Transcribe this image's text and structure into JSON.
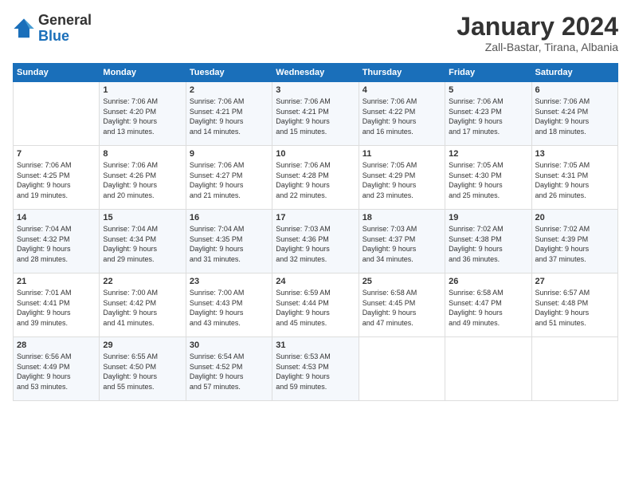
{
  "header": {
    "logo_general": "General",
    "logo_blue": "Blue",
    "month_title": "January 2024",
    "location": "Zall-Bastar, Tirana, Albania"
  },
  "days_of_week": [
    "Sunday",
    "Monday",
    "Tuesday",
    "Wednesday",
    "Thursday",
    "Friday",
    "Saturday"
  ],
  "weeks": [
    [
      {
        "day": "",
        "sunrise": "",
        "sunset": "",
        "daylight": ""
      },
      {
        "day": "1",
        "sunrise": "7:06 AM",
        "sunset": "4:20 PM",
        "daylight": "9 hours and 13 minutes."
      },
      {
        "day": "2",
        "sunrise": "7:06 AM",
        "sunset": "4:21 PM",
        "daylight": "9 hours and 14 minutes."
      },
      {
        "day": "3",
        "sunrise": "7:06 AM",
        "sunset": "4:21 PM",
        "daylight": "9 hours and 15 minutes."
      },
      {
        "day": "4",
        "sunrise": "7:06 AM",
        "sunset": "4:22 PM",
        "daylight": "9 hours and 16 minutes."
      },
      {
        "day": "5",
        "sunrise": "7:06 AM",
        "sunset": "4:23 PM",
        "daylight": "9 hours and 17 minutes."
      },
      {
        "day": "6",
        "sunrise": "7:06 AM",
        "sunset": "4:24 PM",
        "daylight": "9 hours and 18 minutes."
      }
    ],
    [
      {
        "day": "7",
        "sunrise": "7:06 AM",
        "sunset": "4:25 PM",
        "daylight": "9 hours and 19 minutes."
      },
      {
        "day": "8",
        "sunrise": "7:06 AM",
        "sunset": "4:26 PM",
        "daylight": "9 hours and 20 minutes."
      },
      {
        "day": "9",
        "sunrise": "7:06 AM",
        "sunset": "4:27 PM",
        "daylight": "9 hours and 21 minutes."
      },
      {
        "day": "10",
        "sunrise": "7:06 AM",
        "sunset": "4:28 PM",
        "daylight": "9 hours and 22 minutes."
      },
      {
        "day": "11",
        "sunrise": "7:05 AM",
        "sunset": "4:29 PM",
        "daylight": "9 hours and 23 minutes."
      },
      {
        "day": "12",
        "sunrise": "7:05 AM",
        "sunset": "4:30 PM",
        "daylight": "9 hours and 25 minutes."
      },
      {
        "day": "13",
        "sunrise": "7:05 AM",
        "sunset": "4:31 PM",
        "daylight": "9 hours and 26 minutes."
      }
    ],
    [
      {
        "day": "14",
        "sunrise": "7:04 AM",
        "sunset": "4:32 PM",
        "daylight": "9 hours and 28 minutes."
      },
      {
        "day": "15",
        "sunrise": "7:04 AM",
        "sunset": "4:34 PM",
        "daylight": "9 hours and 29 minutes."
      },
      {
        "day": "16",
        "sunrise": "7:04 AM",
        "sunset": "4:35 PM",
        "daylight": "9 hours and 31 minutes."
      },
      {
        "day": "17",
        "sunrise": "7:03 AM",
        "sunset": "4:36 PM",
        "daylight": "9 hours and 32 minutes."
      },
      {
        "day": "18",
        "sunrise": "7:03 AM",
        "sunset": "4:37 PM",
        "daylight": "9 hours and 34 minutes."
      },
      {
        "day": "19",
        "sunrise": "7:02 AM",
        "sunset": "4:38 PM",
        "daylight": "9 hours and 36 minutes."
      },
      {
        "day": "20",
        "sunrise": "7:02 AM",
        "sunset": "4:39 PM",
        "daylight": "9 hours and 37 minutes."
      }
    ],
    [
      {
        "day": "21",
        "sunrise": "7:01 AM",
        "sunset": "4:41 PM",
        "daylight": "9 hours and 39 minutes."
      },
      {
        "day": "22",
        "sunrise": "7:00 AM",
        "sunset": "4:42 PM",
        "daylight": "9 hours and 41 minutes."
      },
      {
        "day": "23",
        "sunrise": "7:00 AM",
        "sunset": "4:43 PM",
        "daylight": "9 hours and 43 minutes."
      },
      {
        "day": "24",
        "sunrise": "6:59 AM",
        "sunset": "4:44 PM",
        "daylight": "9 hours and 45 minutes."
      },
      {
        "day": "25",
        "sunrise": "6:58 AM",
        "sunset": "4:45 PM",
        "daylight": "9 hours and 47 minutes."
      },
      {
        "day": "26",
        "sunrise": "6:58 AM",
        "sunset": "4:47 PM",
        "daylight": "9 hours and 49 minutes."
      },
      {
        "day": "27",
        "sunrise": "6:57 AM",
        "sunset": "4:48 PM",
        "daylight": "9 hours and 51 minutes."
      }
    ],
    [
      {
        "day": "28",
        "sunrise": "6:56 AM",
        "sunset": "4:49 PM",
        "daylight": "9 hours and 53 minutes."
      },
      {
        "day": "29",
        "sunrise": "6:55 AM",
        "sunset": "4:50 PM",
        "daylight": "9 hours and 55 minutes."
      },
      {
        "day": "30",
        "sunrise": "6:54 AM",
        "sunset": "4:52 PM",
        "daylight": "9 hours and 57 minutes."
      },
      {
        "day": "31",
        "sunrise": "6:53 AM",
        "sunset": "4:53 PM",
        "daylight": "9 hours and 59 minutes."
      },
      {
        "day": "",
        "sunrise": "",
        "sunset": "",
        "daylight": ""
      },
      {
        "day": "",
        "sunrise": "",
        "sunset": "",
        "daylight": ""
      },
      {
        "day": "",
        "sunrise": "",
        "sunset": "",
        "daylight": ""
      }
    ]
  ]
}
